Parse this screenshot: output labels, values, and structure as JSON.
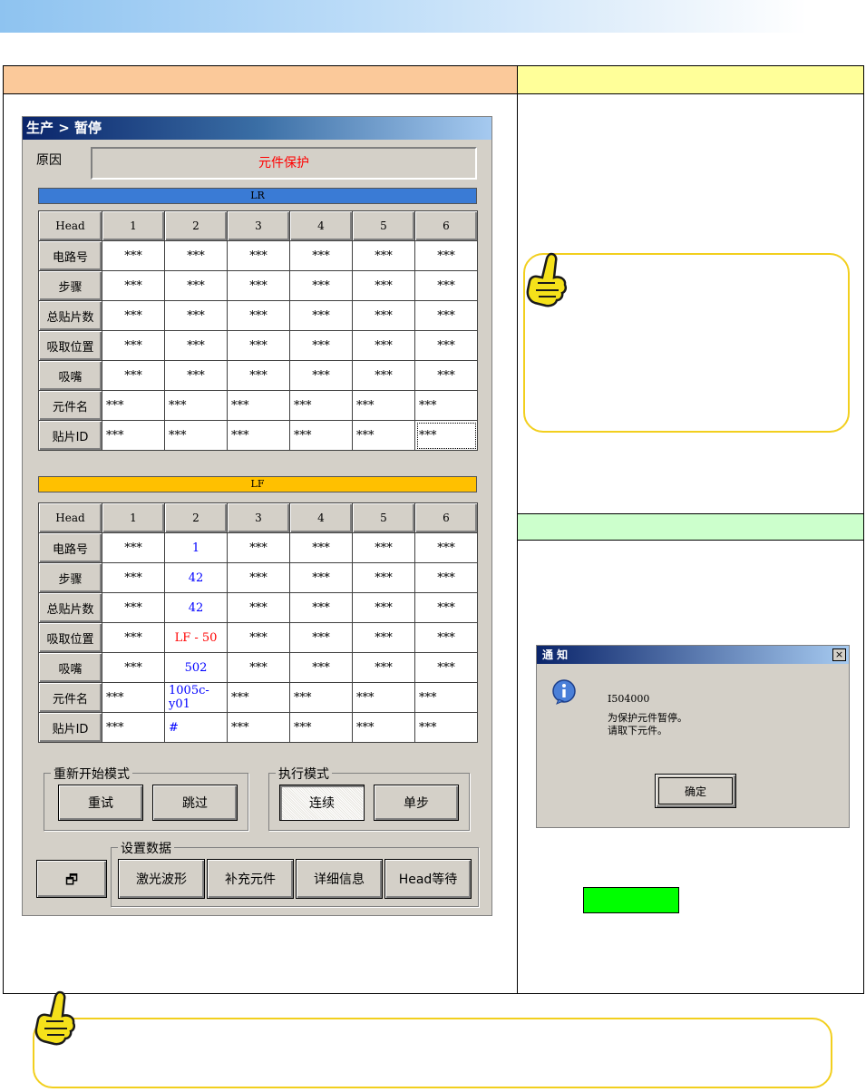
{
  "dialog": {
    "title": "生产 > 暂停",
    "reason_label": "原因",
    "reason_value": "元件保护"
  },
  "lr": {
    "bar_label": "LR",
    "header": [
      "Head",
      "1",
      "2",
      "3",
      "4",
      "5",
      "6"
    ],
    "rows": [
      {
        "label": "电路号",
        "cells": [
          "***",
          "***",
          "***",
          "***",
          "***",
          "***"
        ]
      },
      {
        "label": "步骤",
        "cells": [
          "***",
          "***",
          "***",
          "***",
          "***",
          "***"
        ]
      },
      {
        "label": "总贴片数",
        "cells": [
          "***",
          "***",
          "***",
          "***",
          "***",
          "***"
        ]
      },
      {
        "label": "吸取位置",
        "cells": [
          "***",
          "***",
          "***",
          "***",
          "***",
          "***"
        ]
      },
      {
        "label": "吸嘴",
        "cells": [
          "***",
          "***",
          "***",
          "***",
          "***",
          "***"
        ]
      },
      {
        "label": "元件名",
        "cells": [
          "***",
          "***",
          "***",
          "***",
          "***",
          "***"
        ]
      },
      {
        "label": "贴片ID",
        "cells": [
          "***",
          "***",
          "***",
          "***",
          "***",
          "***"
        ]
      }
    ]
  },
  "lf": {
    "bar_label": "LF",
    "header": [
      "Head",
      "1",
      "2",
      "3",
      "4",
      "5",
      "6"
    ],
    "rows": [
      {
        "label": "电路号",
        "cells": [
          "***",
          "1",
          "***",
          "***",
          "***",
          "***"
        ]
      },
      {
        "label": "步骤",
        "cells": [
          "***",
          "42",
          "***",
          "***",
          "***",
          "***"
        ]
      },
      {
        "label": "总贴片数",
        "cells": [
          "***",
          "42",
          "***",
          "***",
          "***",
          "***"
        ]
      },
      {
        "label": "吸取位置",
        "cells": [
          "***",
          "LF - 50",
          "***",
          "***",
          "***",
          "***"
        ]
      },
      {
        "label": "吸嘴",
        "cells": [
          "***",
          "502",
          "***",
          "***",
          "***",
          "***"
        ]
      },
      {
        "label": "元件名",
        "cells": [
          "***",
          "1005c-y01",
          "***",
          "***",
          "***",
          "***"
        ]
      },
      {
        "label": "贴片ID",
        "cells": [
          "***",
          "#",
          "***",
          "***",
          "***",
          "***"
        ]
      }
    ]
  },
  "restart_mode": {
    "label": "重新开始模式",
    "retry": "重试",
    "skip": "跳过"
  },
  "exec_mode": {
    "label": "执行模式",
    "continuous": "连续",
    "single_step": "单步"
  },
  "settings": {
    "label": "设置数据",
    "laser_waveform": "激光波形",
    "supply_parts": "补充元件",
    "details": "详细信息",
    "head_wait": "Head等待"
  },
  "minimize_glyph": "🗗",
  "notice": {
    "title": "通 知",
    "close": "×",
    "code": "I504000",
    "message_line1": "为保护元件暂停。",
    "message_line2": "请取下元件。",
    "ok": "确定"
  },
  "colors": {
    "lr_bar": "#3a7bd5",
    "lf_bar": "#ffc000",
    "reason_text": "#ff0000",
    "highlight_blue": "#0000ff",
    "highlight_red": "#ff0000",
    "green_button": "#00ff00"
  },
  "icons": [
    "pointing-hand-icon",
    "info-icon",
    "restore-icon",
    "close-icon"
  ]
}
